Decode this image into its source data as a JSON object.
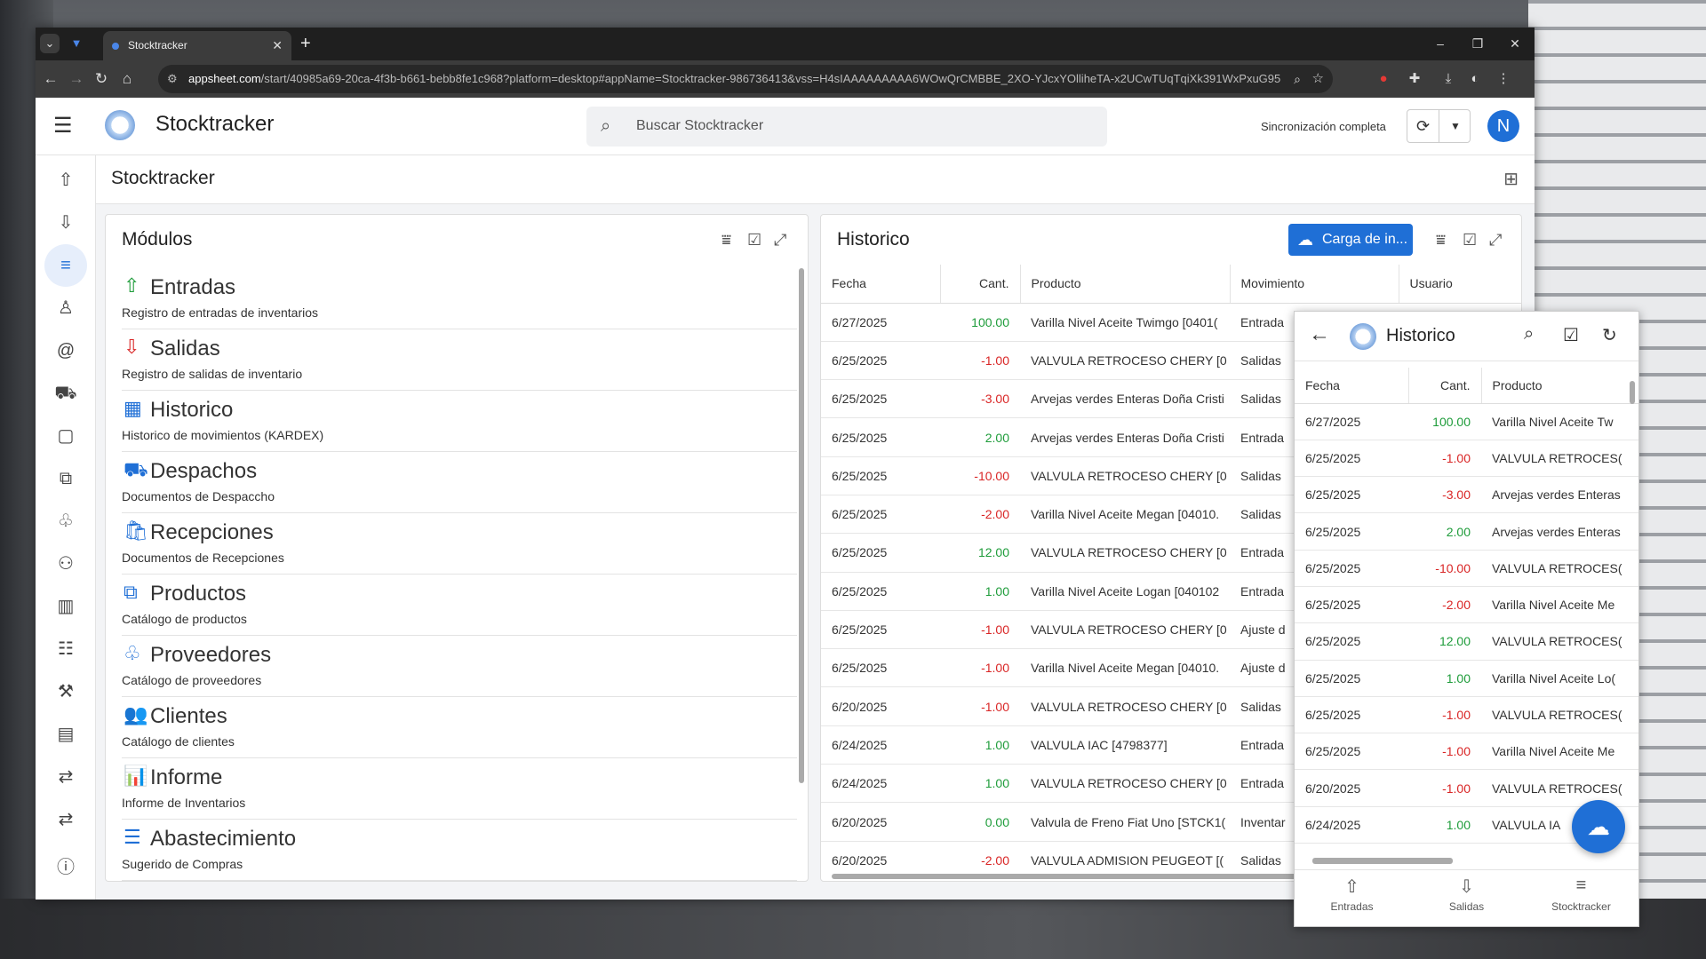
{
  "browser": {
    "tab_title": "Stocktracker",
    "url_host": "appsheet.com",
    "url_rest": "/start/40985a69-20ca-4f3b-b661-bebb8fe1c968?platform=desktop#appName=Stocktracker-986736413&vss=H4sIAAAAAAAAA6WOwQrCMBBE_2XO-YJcxYOlliheTA-x2UCwTUqTqiXk391WxPxuG95M5Nxd_Q..."
  },
  "header": {
    "app_title": "Stocktracker",
    "search_placeholder": "Buscar Stocktracker",
    "sync_status": "Sincronización completa",
    "avatar_initial": "N"
  },
  "breadcrumb": {
    "title": "Stocktracker"
  },
  "modulos": {
    "title": "Módulos",
    "items": [
      {
        "name": "Entradas",
        "desc": "Registro de entradas de inventarios",
        "icon": "upload-arrow-icon",
        "glyph": "⇧"
      },
      {
        "name": "Salidas",
        "desc": "Registro de salidas de inventario",
        "icon": "download-arrow-icon",
        "glyph": "⇩"
      },
      {
        "name": "Historico",
        "desc": "Historico de movimientos (KARDEX)",
        "icon": "table-grid-icon",
        "glyph": "▦"
      },
      {
        "name": "Despachos",
        "desc": "Documentos de Despaccho",
        "icon": "dolly-icon",
        "glyph": "⛟"
      },
      {
        "name": "Recepciones",
        "desc": "Documentos de Recepciones",
        "icon": "shopping-bag-icon",
        "glyph": "🛍"
      },
      {
        "name": "Productos",
        "desc": "Catálogo de productos",
        "icon": "boxes-icon",
        "glyph": "⧉"
      },
      {
        "name": "Proveedores",
        "desc": "Catálogo de proveedores",
        "icon": "handshake-icon",
        "glyph": "♧"
      },
      {
        "name": "Clientes",
        "desc": "Catálogo de clientes",
        "icon": "users-icon",
        "glyph": "👥"
      },
      {
        "name": "Informe",
        "desc": "Informe de Inventarios",
        "icon": "chart-icon",
        "glyph": "📊"
      },
      {
        "name": "Abastecimiento",
        "desc": "Sugerido de Compras",
        "icon": "checklist-icon",
        "glyph": "☰"
      }
    ]
  },
  "historico": {
    "title": "Historico",
    "carga_label": "Carga de in...",
    "columns": [
      "Fecha",
      "Cant.",
      "Producto",
      "Movimiento",
      "Usuario"
    ],
    "rows": [
      {
        "fecha": "6/27/2025",
        "cant": "100.00",
        "producto": "Varilla Nivel Aceite Twimgo [0401(",
        "mov": "Entrada"
      },
      {
        "fecha": "6/25/2025",
        "cant": "-1.00",
        "producto": "VALVULA RETROCESO CHERY [0",
        "mov": "Salidas"
      },
      {
        "fecha": "6/25/2025",
        "cant": "-3.00",
        "producto": "Arvejas verdes Enteras Doña Cristi",
        "mov": "Salidas"
      },
      {
        "fecha": "6/25/2025",
        "cant": "2.00",
        "producto": "Arvejas verdes Enteras Doña Cristi",
        "mov": "Entrada"
      },
      {
        "fecha": "6/25/2025",
        "cant": "-10.00",
        "producto": "VALVULA RETROCESO CHERY [0",
        "mov": "Salidas"
      },
      {
        "fecha": "6/25/2025",
        "cant": "-2.00",
        "producto": "Varilla Nivel Aceite Megan [04010.",
        "mov": "Salidas"
      },
      {
        "fecha": "6/25/2025",
        "cant": "12.00",
        "producto": "VALVULA RETROCESO CHERY [0",
        "mov": "Entrada"
      },
      {
        "fecha": "6/25/2025",
        "cant": "1.00",
        "producto": "Varilla Nivel Aceite Logan [040102",
        "mov": "Entrada"
      },
      {
        "fecha": "6/25/2025",
        "cant": "-1.00",
        "producto": "VALVULA RETROCESO CHERY [0",
        "mov": "Ajuste d"
      },
      {
        "fecha": "6/25/2025",
        "cant": "-1.00",
        "producto": "Varilla Nivel Aceite Megan [04010.",
        "mov": "Ajuste d"
      },
      {
        "fecha": "6/20/2025",
        "cant": "-1.00",
        "producto": "VALVULA RETROCESO CHERY [0",
        "mov": "Salidas"
      },
      {
        "fecha": "6/24/2025",
        "cant": "1.00",
        "producto": "VALVULA IAC [4798377]",
        "mov": "Entrada"
      },
      {
        "fecha": "6/24/2025",
        "cant": "1.00",
        "producto": "VALVULA RETROCESO CHERY [0",
        "mov": "Entrada"
      },
      {
        "fecha": "6/20/2025",
        "cant": "0.00",
        "producto": "Valvula de Freno Fiat Uno [STCK1(",
        "mov": "Inventar"
      },
      {
        "fecha": "6/20/2025",
        "cant": "-2.00",
        "producto": "VALVULA ADMISION PEUGEOT [(",
        "mov": "Salidas"
      }
    ]
  },
  "mobile": {
    "title": "Historico",
    "columns": [
      "Fecha",
      "Cant.",
      "Producto"
    ],
    "rows": [
      {
        "fecha": "6/27/2025",
        "cant": "100.00",
        "producto": "Varilla Nivel Aceite Tw"
      },
      {
        "fecha": "6/25/2025",
        "cant": "-1.00",
        "producto": "VALVULA RETROCES("
      },
      {
        "fecha": "6/25/2025",
        "cant": "-3.00",
        "producto": "Arvejas verdes Enteras"
      },
      {
        "fecha": "6/25/2025",
        "cant": "2.00",
        "producto": "Arvejas verdes Enteras"
      },
      {
        "fecha": "6/25/2025",
        "cant": "-10.00",
        "producto": "VALVULA RETROCES("
      },
      {
        "fecha": "6/25/2025",
        "cant": "-2.00",
        "producto": "Varilla Nivel Aceite Me"
      },
      {
        "fecha": "6/25/2025",
        "cant": "12.00",
        "producto": "VALVULA RETROCES("
      },
      {
        "fecha": "6/25/2025",
        "cant": "1.00",
        "producto": "Varilla Nivel Aceite Lo("
      },
      {
        "fecha": "6/25/2025",
        "cant": "-1.00",
        "producto": "VALVULA RETROCES("
      },
      {
        "fecha": "6/25/2025",
        "cant": "-1.00",
        "producto": "Varilla Nivel Aceite Me"
      },
      {
        "fecha": "6/20/2025",
        "cant": "-1.00",
        "producto": "VALVULA RETROCES("
      },
      {
        "fecha": "6/24/2025",
        "cant": "1.00",
        "producto": "VALVULA IA"
      }
    ],
    "bottom_nav": [
      {
        "label": "Entradas",
        "icon": "upload-arrow-icon",
        "glyph": "⇧"
      },
      {
        "label": "Salidas",
        "icon": "download-arrow-icon",
        "glyph": "⇩"
      },
      {
        "label": "Stocktracker",
        "icon": "menu-lines-icon",
        "glyph": "≡"
      }
    ]
  },
  "colors": {
    "accent": "#1f6fd6",
    "positive": "#1e9c3a",
    "negative": "#d92525"
  }
}
